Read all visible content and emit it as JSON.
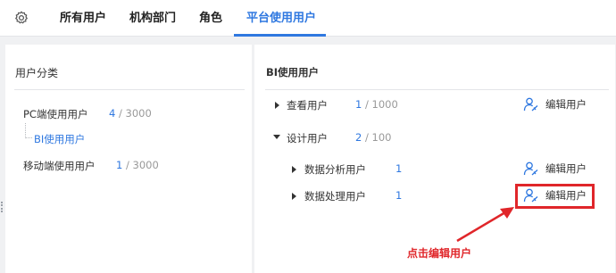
{
  "tabs": [
    {
      "label": "所有用户"
    },
    {
      "label": "机构部门"
    },
    {
      "label": "角色"
    },
    {
      "label": "平台使用用户",
      "active": true
    }
  ],
  "left_panel": {
    "title": "用户分类",
    "items": [
      {
        "label": "PC端使用用户",
        "current": "4",
        "max": "3000"
      },
      {
        "label": "BI使用用户"
      },
      {
        "label": "移动端使用用户",
        "current": "1",
        "max": "3000"
      }
    ]
  },
  "right_panel": {
    "title": "BI使用用户",
    "groups": [
      {
        "label": "查看用户",
        "current": "1",
        "max": "1000",
        "action": "编辑用户"
      },
      {
        "label": "设计用户",
        "current": "2",
        "max": "100"
      },
      {
        "label": "数据分析用户",
        "current": "1",
        "action": "编辑用户"
      },
      {
        "label": "数据处理用户",
        "current": "1",
        "action": "编辑用户"
      }
    ],
    "count_separator": "/"
  },
  "annotation": {
    "text": "点击编辑用户",
    "color": "#e0262a"
  },
  "colors": {
    "accent": "#2f78e0",
    "highlight": "#e0262a"
  }
}
